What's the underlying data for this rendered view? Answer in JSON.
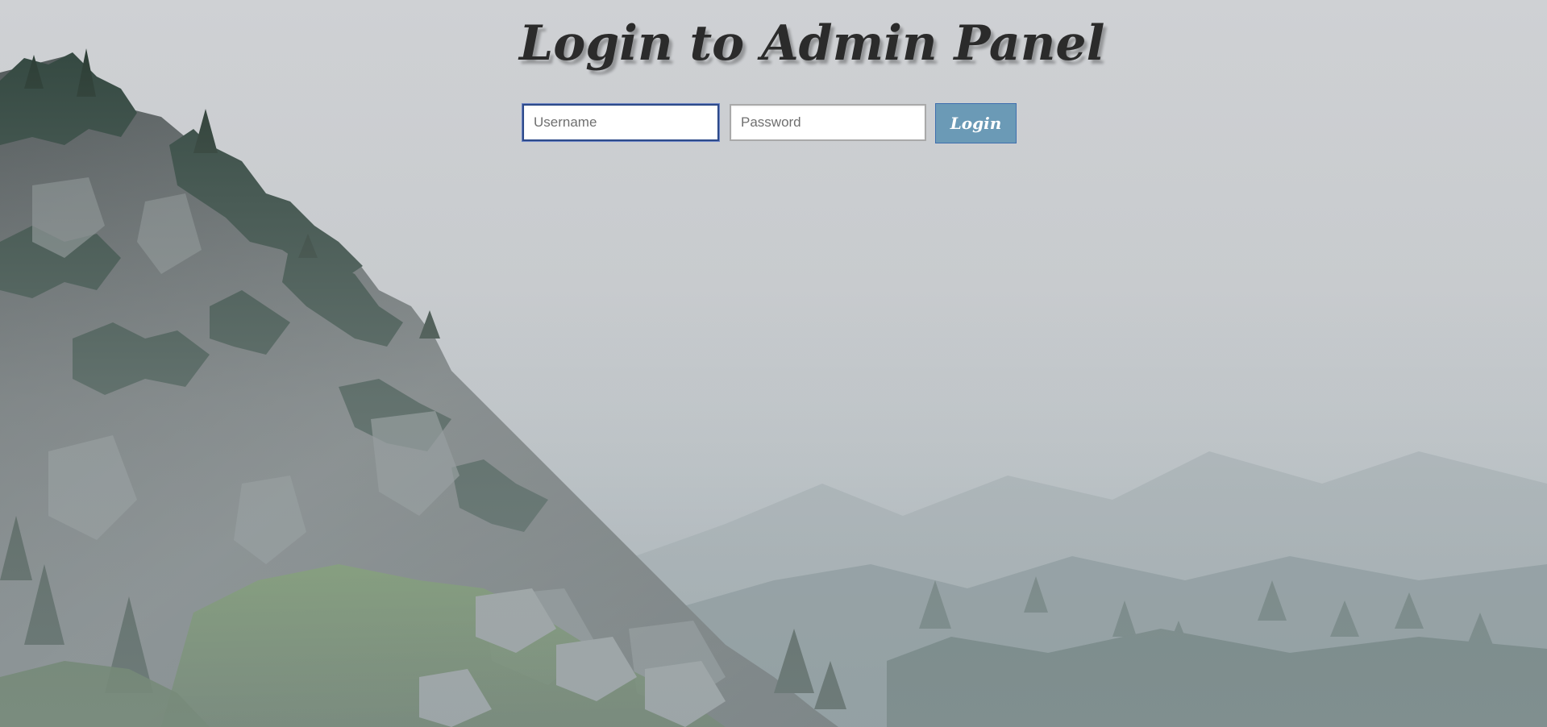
{
  "page": {
    "title": "Login to Admin Panel"
  },
  "form": {
    "username": {
      "placeholder": "Username",
      "value": ""
    },
    "password": {
      "placeholder": "Password",
      "value": ""
    },
    "submit_label": "Login"
  },
  "colors": {
    "title": "#2b2b2b",
    "button_bg": "#6b9ab6",
    "button_border": "#3f6fae",
    "focus_border": "#2d4a8a",
    "sky": "#cfd1d4",
    "rock": "#5d6466",
    "forest": "#2f4a3a",
    "moss": "#6f9a4a"
  }
}
